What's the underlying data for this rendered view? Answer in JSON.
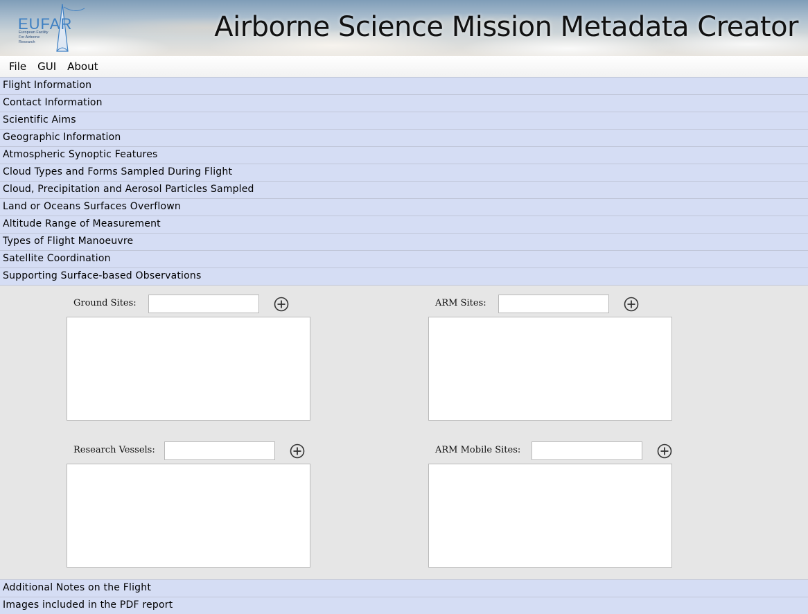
{
  "banner": {
    "title": "Airborne Science Mission Metadata Creator",
    "logo": {
      "text": "EUFAR",
      "subtitle": "European Facility For Airborne Research"
    }
  },
  "menu": {
    "items": [
      "File",
      "GUI",
      "About"
    ]
  },
  "sections": {
    "flight_information": "Flight Information",
    "contact_information": "Contact Information",
    "scientific_aims": "Scientific Aims",
    "geographic_information": "Geographic Information",
    "atmospheric_synoptic_features": "Atmospheric Synoptic Features",
    "cloud_types": "Cloud Types and Forms Sampled During Flight",
    "cloud_precip_aerosol": "Cloud, Precipitation and Aerosol Particles Sampled",
    "land_ocean": "Land or Oceans Surfaces Overflown",
    "altitude_range": "Altitude Range of Measurement",
    "flight_manoeuvre": "Types of Flight Manoeuvre",
    "satellite_coordination": "Satellite Coordination",
    "surface_observations": "Supporting Surface-based Observations",
    "additional_notes": "Additional Notes on the Flight",
    "images_pdf": "Images included in the PDF report"
  },
  "surface_obs": {
    "ground_sites": {
      "label": "Ground Sites:",
      "value": "",
      "items": []
    },
    "arm_sites": {
      "label": "ARM Sites:",
      "value": "",
      "items": []
    },
    "research_vessels": {
      "label": "Research Vessels:",
      "value": "",
      "items": []
    },
    "arm_mobile_sites": {
      "label": "ARM Mobile Sites:",
      "value": "",
      "items": []
    }
  },
  "icons": {
    "add": "plus-circle-icon"
  }
}
